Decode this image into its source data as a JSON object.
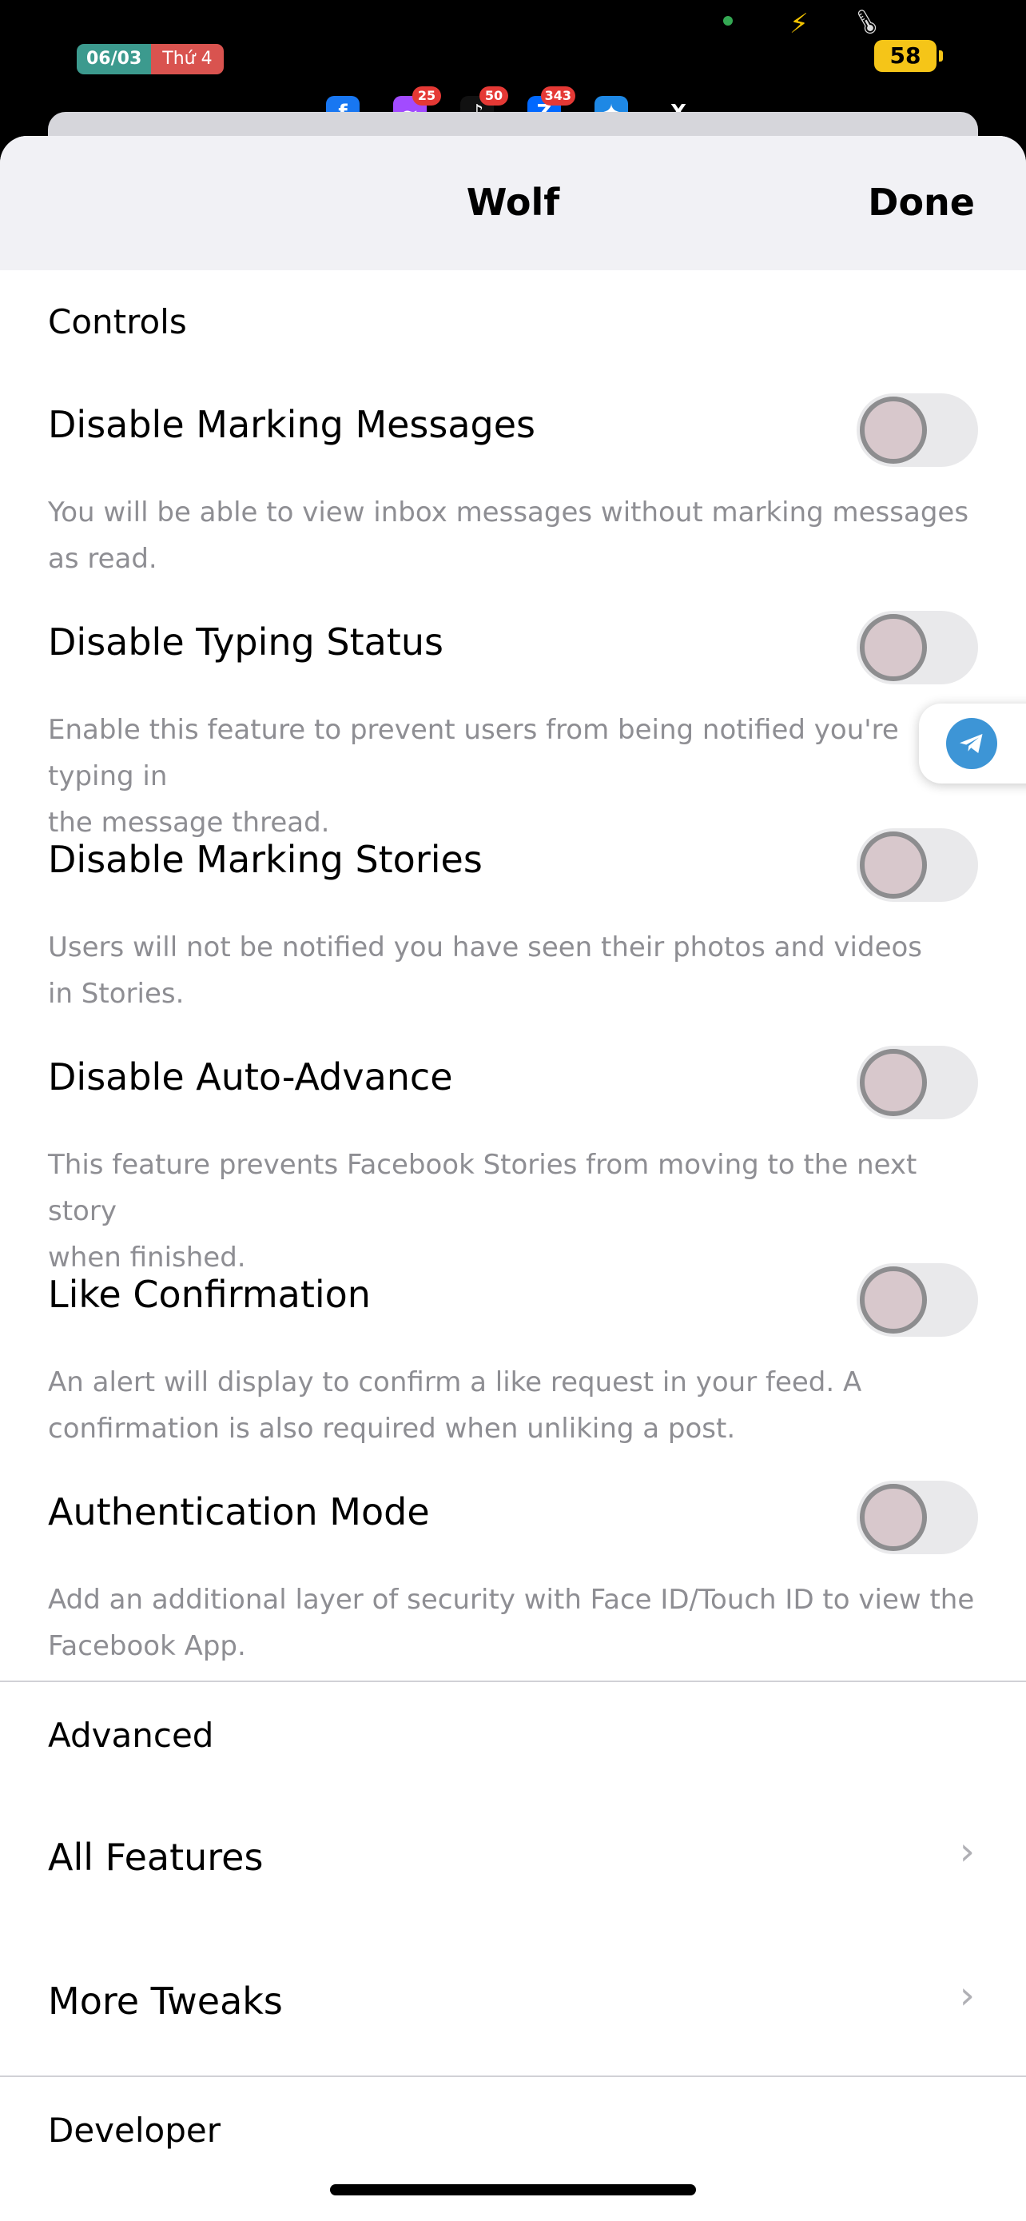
{
  "status_bar": {
    "date": "06/03",
    "weekday": "Thứ 4",
    "battery": "58",
    "apps": [
      {
        "name": "facebook-icon",
        "color": "#1877f2",
        "glyph": "f",
        "badge": ""
      },
      {
        "name": "messenger-icon",
        "color": "#a24bff",
        "glyph": "~",
        "badge": "25"
      },
      {
        "name": "tiktok-icon",
        "color": "#111111",
        "glyph": "♪",
        "badge": "50"
      },
      {
        "name": "zalo-icon",
        "color": "#0068ff",
        "glyph": "Z",
        "badge": "343"
      },
      {
        "name": "safari-icon",
        "color": "#1e88e5",
        "glyph": "✦",
        "badge": ""
      },
      {
        "name": "x-icon",
        "color": "#000000",
        "glyph": "X",
        "badge": ""
      }
    ]
  },
  "navbar": {
    "title": "Wolf",
    "done_label": "Done"
  },
  "controls": {
    "header": "Controls",
    "items": [
      {
        "title": "Disable Marking Messages",
        "desc_lines": [
          "You will be able to view inbox messages without marking messages",
          "as read."
        ],
        "enabled": false
      },
      {
        "title": "Disable Typing Status",
        "desc_lines": [
          "Enable this feature to prevent users from being notified you're typing in",
          "the message thread."
        ],
        "enabled": false
      },
      {
        "title": "Disable Marking Stories",
        "desc_lines": [
          "Users will not be notified you have seen their photos and videos",
          "in Stories."
        ],
        "enabled": false
      },
      {
        "title": "Disable Auto-Advance",
        "desc_lines": [
          "This feature prevents Facebook Stories from moving to the next story",
          "when finished."
        ],
        "enabled": false
      },
      {
        "title": "Like Confirmation",
        "desc_lines": [
          "An alert will display to confirm a like request in your feed. A",
          "confirmation is also required when unliking a post."
        ],
        "enabled": false
      },
      {
        "title": "Authentication Mode",
        "desc_lines": [
          "Add an additional layer of security with Face ID/Touch ID to view the",
          "Facebook App."
        ],
        "enabled": false
      }
    ]
  },
  "advanced": {
    "header": "Advanced",
    "items": [
      {
        "label": "All Features"
      },
      {
        "label": "More Tweaks"
      }
    ]
  },
  "developer": {
    "header": "Developer"
  }
}
